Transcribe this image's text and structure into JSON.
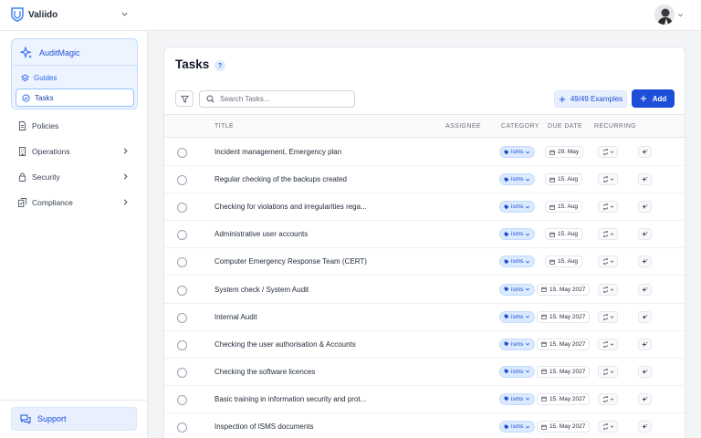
{
  "app": {
    "name": "Valiido"
  },
  "sidebar": {
    "auditmagic": {
      "title": "AuditMagic",
      "guides": "Guides",
      "tasks": "Tasks"
    },
    "items": [
      {
        "label": "Policies",
        "icon": "document-icon",
        "has_chevron": false
      },
      {
        "label": "Operations",
        "icon": "building-icon",
        "has_chevron": true
      },
      {
        "label": "Security",
        "icon": "lock-icon",
        "has_chevron": true
      },
      {
        "label": "Compliance",
        "icon": "badge-check-icon",
        "has_chevron": true
      }
    ],
    "support": "Support"
  },
  "main": {
    "title": "Tasks",
    "help": "?",
    "search_placeholder": "Search Tasks...",
    "examples_label": "49/49 Examples",
    "add_label": "Add",
    "columns": {
      "title": "TITLE",
      "assignee": "ASSIGNEE",
      "category": "CATEGORY",
      "due": "DUE DATE",
      "recurring": "RECURRING"
    },
    "rows": [
      {
        "title": "Incident management, Emergency plan",
        "category": "isms",
        "due": "29. May"
      },
      {
        "title": "Regular checking of the backups created",
        "category": "isms",
        "due": "15. Aug"
      },
      {
        "title": "Checking for violations and irregularities rega...",
        "category": "isms",
        "due": "15. Aug"
      },
      {
        "title": "Administrative user accounts",
        "category": "isms",
        "due": "15. Aug"
      },
      {
        "title": "Computer Emergency Response Team (CERT)",
        "category": "isms",
        "due": "15. Aug"
      },
      {
        "title": "System check / System Audit",
        "category": "isms",
        "due": "15. May 2027"
      },
      {
        "title": "Internal Audit",
        "category": "isms",
        "due": "15. May 2027"
      },
      {
        "title": "Checking the user authorisation & Accounts",
        "category": "isms",
        "due": "15. May 2027"
      },
      {
        "title": "Checking the software licences",
        "category": "isms",
        "due": "15. May 2027"
      },
      {
        "title": "Basic training in information security and prot...",
        "category": "isms",
        "due": "15. May 2027"
      },
      {
        "title": "Inspection of ISMS documents",
        "category": "isms",
        "due": "15. May 2027"
      }
    ]
  }
}
